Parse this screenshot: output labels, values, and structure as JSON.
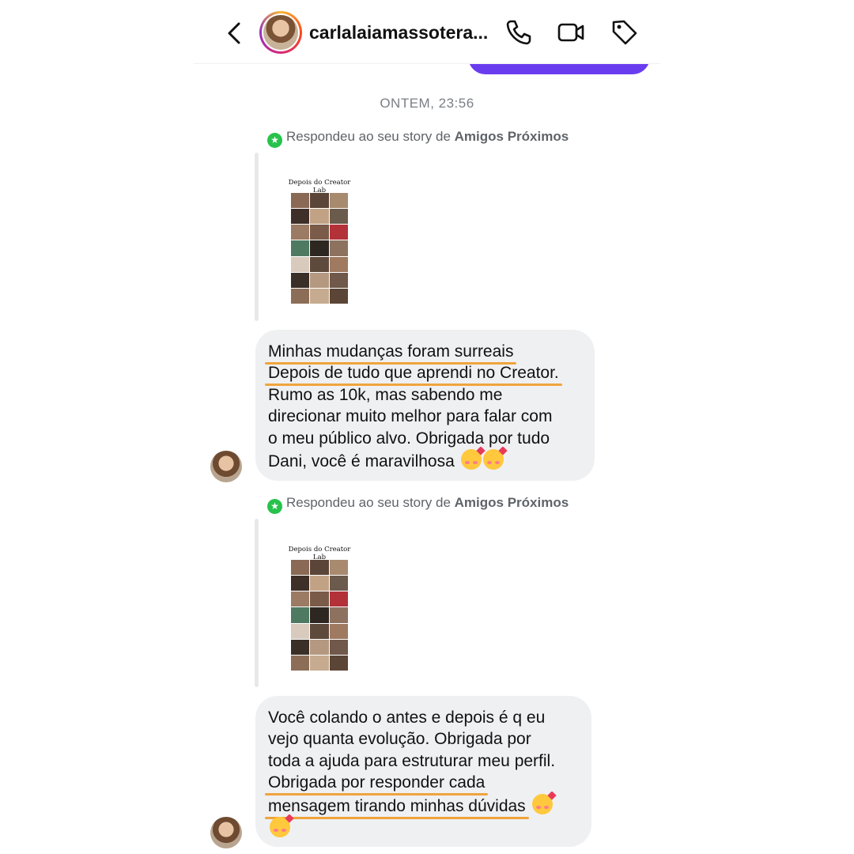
{
  "header": {
    "username": "carlalaiamassotera...",
    "icons": [
      "back-icon",
      "phone-icon",
      "video-icon",
      "tag-icon"
    ]
  },
  "timestamp": "ONTEM, 23:56",
  "reply_note": {
    "prefix": "Respondeu ao seu story de",
    "audience": "Amigos Próximos"
  },
  "story": {
    "title": "Depois do Creator Lab"
  },
  "messages": [
    {
      "lines": [
        "Minhas mudanças foram surreais",
        "Depois de tudo que aprendi no Creator.",
        "Rumo as 10k, mas sabendo me",
        "direcionar muito melhor para falar com",
        "o meu público alvo. Obrigada por tudo",
        "Dani, você é maravilhosa"
      ]
    },
    {
      "lines": [
        "Você colando o antes e depois é q eu",
        "vejo quanta evolução. Obrigada por",
        "toda a ajuda para estruturar meu perfil.",
        "Obrigada por responder cada",
        "mensagem tirando minhas dúvidas"
      ]
    }
  ],
  "colors": {
    "accent_purple": "#6a3cf0",
    "underline": "#f0a43c",
    "bubble_bg": "#eff0f2",
    "close_friends_green": "#27c24c"
  }
}
